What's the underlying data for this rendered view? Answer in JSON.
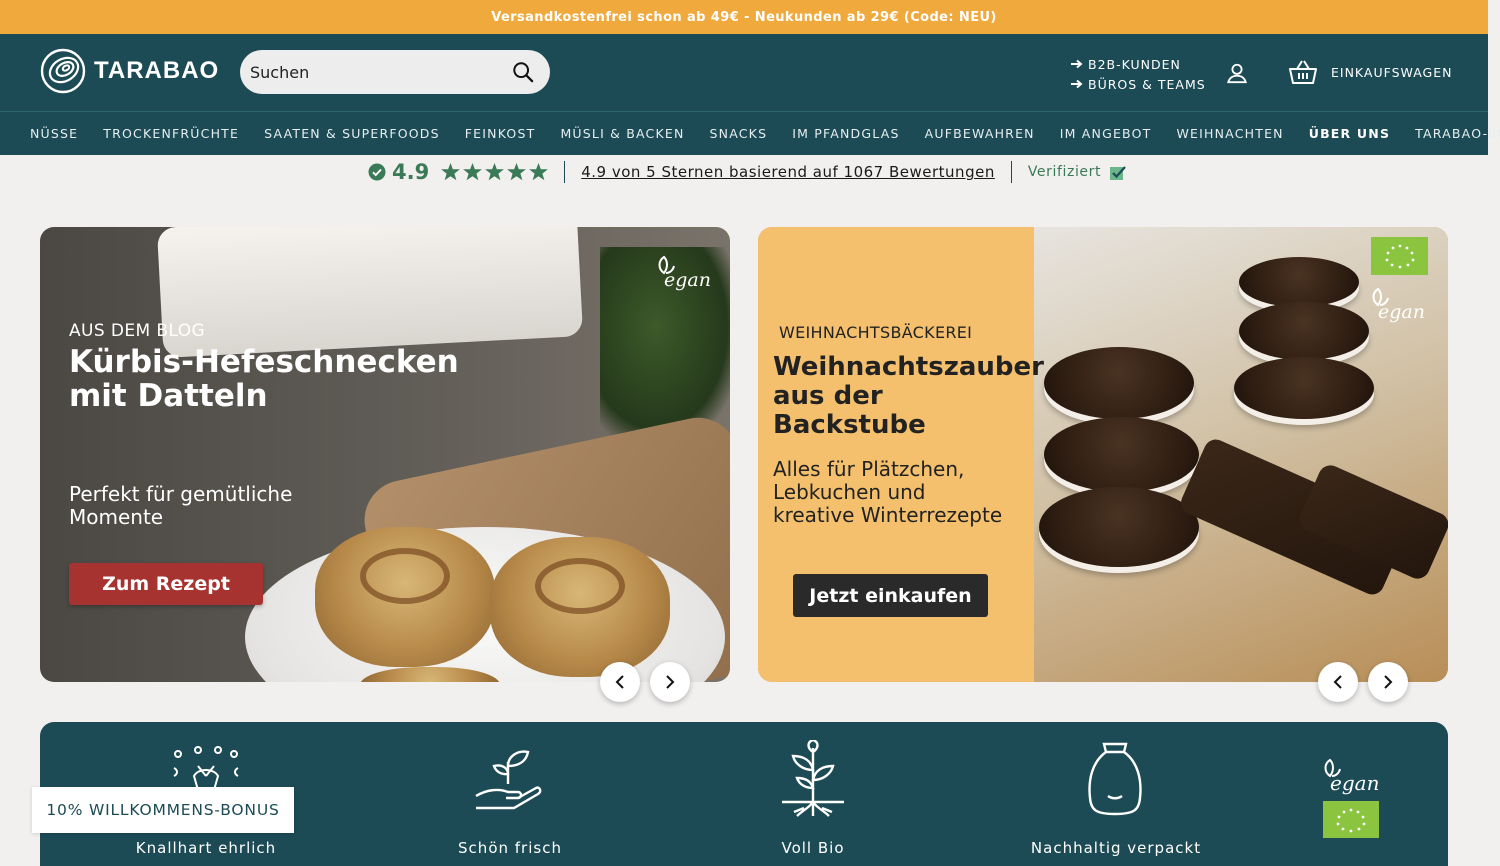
{
  "announcement": "Versandkostenfrei schon ab 49€ - Neukunden ab 29€ (Code: NEU)",
  "header": {
    "logo_text": "TARABAO",
    "search_placeholder": "Suchen",
    "b2b_label": "B2B-KUNDEN",
    "offices_label": "BÜROS & TEAMS",
    "cart_label": "EINKAUFSWAGEN"
  },
  "nav": {
    "items": [
      "NÜSSE",
      "TROCKENFRÜCHTE",
      "SAATEN & SUPERFOODS",
      "FEINKOST",
      "MÜSLI & BACKEN",
      "SNACKS",
      "IM PFANDGLAS",
      "AUFBEWAHREN",
      "IM ANGEBOT",
      "WEIHNACHTEN",
      "ÜBER UNS",
      "TARABAO-BLOG"
    ]
  },
  "rating": {
    "score": "4.9",
    "stars": 5,
    "text": "4.9 von 5 Sternen basierend auf 1067 Bewertungen",
    "verified": "Verifiziert"
  },
  "slide1": {
    "kicker": "AUS DEM BLOG",
    "title": "Kürbis-Hefeschnecken mit Datteln",
    "subtitle": "Perfekt für gemütliche Momente",
    "button": "Zum Rezept",
    "badge": "vegan"
  },
  "slide2": {
    "kicker": "WEIHNACHTSBÄCKEREI",
    "title": "Weihnachtszauber aus der Backstube",
    "subtitle": "Alles für Plätzchen, Lebkuchen und kreative Winterrezepte",
    "button": "Jetzt einkaufen",
    "badge": "vegan"
  },
  "features": {
    "items": [
      "Knallhart ehrlich",
      "Schön frisch",
      "Voll Bio",
      "Nachhaltig verpackt"
    ],
    "vegan_badge": "vegan"
  },
  "bonus": "10% WILLKOMMENS-BONUS",
  "colors": {
    "brand": "#1c4b55",
    "announcement": "#f0a93c",
    "rating_green": "#3a7a56",
    "recipe_button": "#a73330"
  }
}
